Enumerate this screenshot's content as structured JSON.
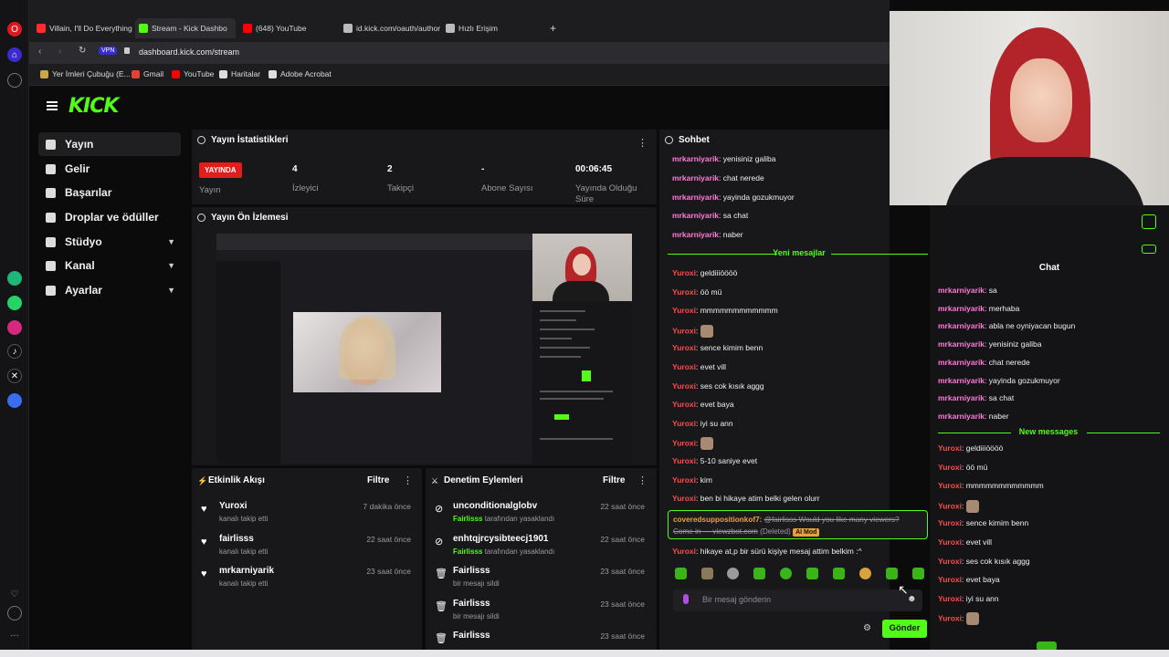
{
  "browser": {
    "tabs": [
      {
        "label": "Villain, I'll Do Everything E",
        "color": "#ff2d2d"
      },
      {
        "label": "Stream - Kick Dashbo",
        "color": "#53fc18"
      },
      {
        "label": "(648) YouTube",
        "color": "#ff0000"
      },
      {
        "label": "id.kick.com/oauth/authori",
        "color": "#bbbbbb"
      },
      {
        "label": "Hızlı Erişim",
        "color": "#bbbbbb"
      }
    ],
    "vpn_label": "VPN",
    "url": "dashboard.kick.com/stream",
    "bookmarks": [
      "Yer İmleri Çubuğu (E...",
      "Gmail",
      "YouTube",
      "Haritalar",
      "Adobe Acrobat"
    ]
  },
  "kick": {
    "logo": "KICK"
  },
  "nav": [
    {
      "label": "Yayın",
      "icon": "broadcast-icon",
      "active": true
    },
    {
      "label": "Gelir",
      "icon": "revenue-icon"
    },
    {
      "label": "Başarılar",
      "icon": "trophy-icon"
    },
    {
      "label": "Droplar ve ödüller",
      "icon": "gift-icon"
    },
    {
      "label": "Stüdyo",
      "icon": "studio-icon",
      "chevron": true
    },
    {
      "label": "Kanal",
      "icon": "channel-icon",
      "chevron": true
    },
    {
      "label": "Ayarlar",
      "icon": "settings-icon",
      "chevron": true
    }
  ],
  "stats": {
    "title": "Yayın İstatistikleri",
    "live_badge": "YAYINDA",
    "live_label": "Yayın",
    "viewers_value": "4",
    "viewers_label": "İzleyici",
    "followers_value": "2",
    "followers_label": "Takipçi",
    "subs_value": "-",
    "subs_label": "Abone Sayısı",
    "uptime_value": "00:06:45",
    "uptime_label": "Yayında Olduğu Süre"
  },
  "preview": {
    "title": "Yayın Ön İzlemesi"
  },
  "activity": {
    "title": "Etkinlik Akışı",
    "filter": "Filtre",
    "items": [
      {
        "name": "Yuroxi",
        "sub": "kanalı takip etti",
        "time": "7 dakika önce"
      },
      {
        "name": "fairlisss",
        "sub": "kanalı takip etti",
        "time": "22 saat önce"
      },
      {
        "name": "mrkarniyarik",
        "sub": "kanalı takip etti",
        "time": "23 saat önce"
      }
    ]
  },
  "moderation": {
    "title": "Denetim Eylemleri",
    "filter": "Filtre",
    "items": [
      {
        "name": "unconditionalglobv",
        "sub_actor": "Fairlisss",
        "sub": "tarafından yasaklandı",
        "time": "22 saat önce"
      },
      {
        "name": "enhtqjrcysibteecj1901",
        "sub_actor": "Fairlisss",
        "sub": "tarafından yasaklandı",
        "time": "22 saat önce"
      },
      {
        "name": "Fairlisss",
        "sub_actor": "",
        "sub": "bir mesajı sildi",
        "time": "23 saat önce"
      },
      {
        "name": "Fairlisss",
        "sub_actor": "",
        "sub": "bir mesajı sildi",
        "time": "23 saat önce"
      },
      {
        "name": "Fairlisss",
        "sub_actor": "",
        "sub": "",
        "time": "23 saat önce"
      }
    ]
  },
  "chat": {
    "title": "Sohbet",
    "old_messages": [
      {
        "user": "mrkarniyarik",
        "text": "yenisiniz galiba"
      },
      {
        "user": "mrkarniyarik",
        "text": "chat nerede"
      },
      {
        "user": "mrkarniyarik",
        "text": "yayinda gozukmuyor"
      },
      {
        "user": "mrkarniyarik",
        "text": "sa chat"
      },
      {
        "user": "mrkarniyarik",
        "text": "naber"
      }
    ],
    "new_label": "Yeni mesajlar",
    "new_messages": [
      {
        "user": "Yuroxi",
        "text": "geldiiiöööö"
      },
      {
        "user": "Yuroxi",
        "text": "öö mü"
      },
      {
        "user": "Yuroxi",
        "text": "mmmmmmmmmmmm"
      },
      {
        "user": "Yuroxi",
        "text": "",
        "emote": true
      },
      {
        "user": "Yuroxi",
        "text": "sence kimim benn"
      },
      {
        "user": "Yuroxi",
        "text": "evet vill"
      },
      {
        "user": "Yuroxi",
        "text": "ses cok kısık aggg"
      },
      {
        "user": "Yuroxi",
        "text": "evet baya"
      },
      {
        "user": "Yuroxi",
        "text": "iyi su ann"
      },
      {
        "user": "Yuroxi",
        "text": "",
        "emote": true
      },
      {
        "user": "Yuroxi",
        "text": "5-10 saniye evet"
      },
      {
        "user": "Yuroxi",
        "text": "kim"
      },
      {
        "user": "Yuroxi",
        "text": "ben bi hikaye atim belki gelen olurr"
      }
    ],
    "deleted_user": "coveredsuppositionkof7:",
    "deleted_text_1": "@fairlisss Would you like many viewers?",
    "deleted_text_2": "Come in — viewzbot.com",
    "deleted_tag": "(Deleted)",
    "automod": "AI Mod",
    "last_user": "Yuroxi",
    "last_text": "hikaye at,p bir sürü kişiye mesaj attim belkim :^",
    "input_placeholder": "Bir mesaj gönderin",
    "send_label": "Gönder"
  },
  "overlay": {
    "title": "Chat",
    "old_messages": [
      {
        "user": "mrkarniyarik",
        "text": "sa"
      },
      {
        "user": "mrkarniyarik",
        "text": "merhaba"
      },
      {
        "user": "mrkarniyarik",
        "text": "abla ne oyniyacan bugun"
      },
      {
        "user": "mrkarniyarik",
        "text": "yenisiniz galiba"
      },
      {
        "user": "mrkarniyarik",
        "text": "chat nerede"
      },
      {
        "user": "mrkarniyarik",
        "text": "yayinda gozukmuyor"
      },
      {
        "user": "mrkarniyarik",
        "text": "sa chat"
      },
      {
        "user": "mrkarniyarik",
        "text": "naber"
      }
    ],
    "new_label": "New messages",
    "new_messages": [
      {
        "user": "Yuroxi",
        "text": "geldiiiöööö"
      },
      {
        "user": "Yuroxi",
        "text": "öö mü"
      },
      {
        "user": "Yuroxi",
        "text": "mmmmmmmmmmmm"
      },
      {
        "user": "Yuroxi",
        "text": "",
        "emote": true
      },
      {
        "user": "Yuroxi",
        "text": "sence kimim benn"
      },
      {
        "user": "Yuroxi",
        "text": "evet vill"
      },
      {
        "user": "Yuroxi",
        "text": "ses cok kısık aggg"
      },
      {
        "user": "Yuroxi",
        "text": "evet baya"
      },
      {
        "user": "Yuroxi",
        "text": "iyi su ann"
      },
      {
        "user": "Yuroxi",
        "text": "",
        "emote": true
      }
    ]
  },
  "colors": {
    "kick_green": "#53fc18",
    "chat_user_old": "#ff7ad9",
    "chat_user_new": "#ff4a4a",
    "live_red": "#e21d1d"
  }
}
